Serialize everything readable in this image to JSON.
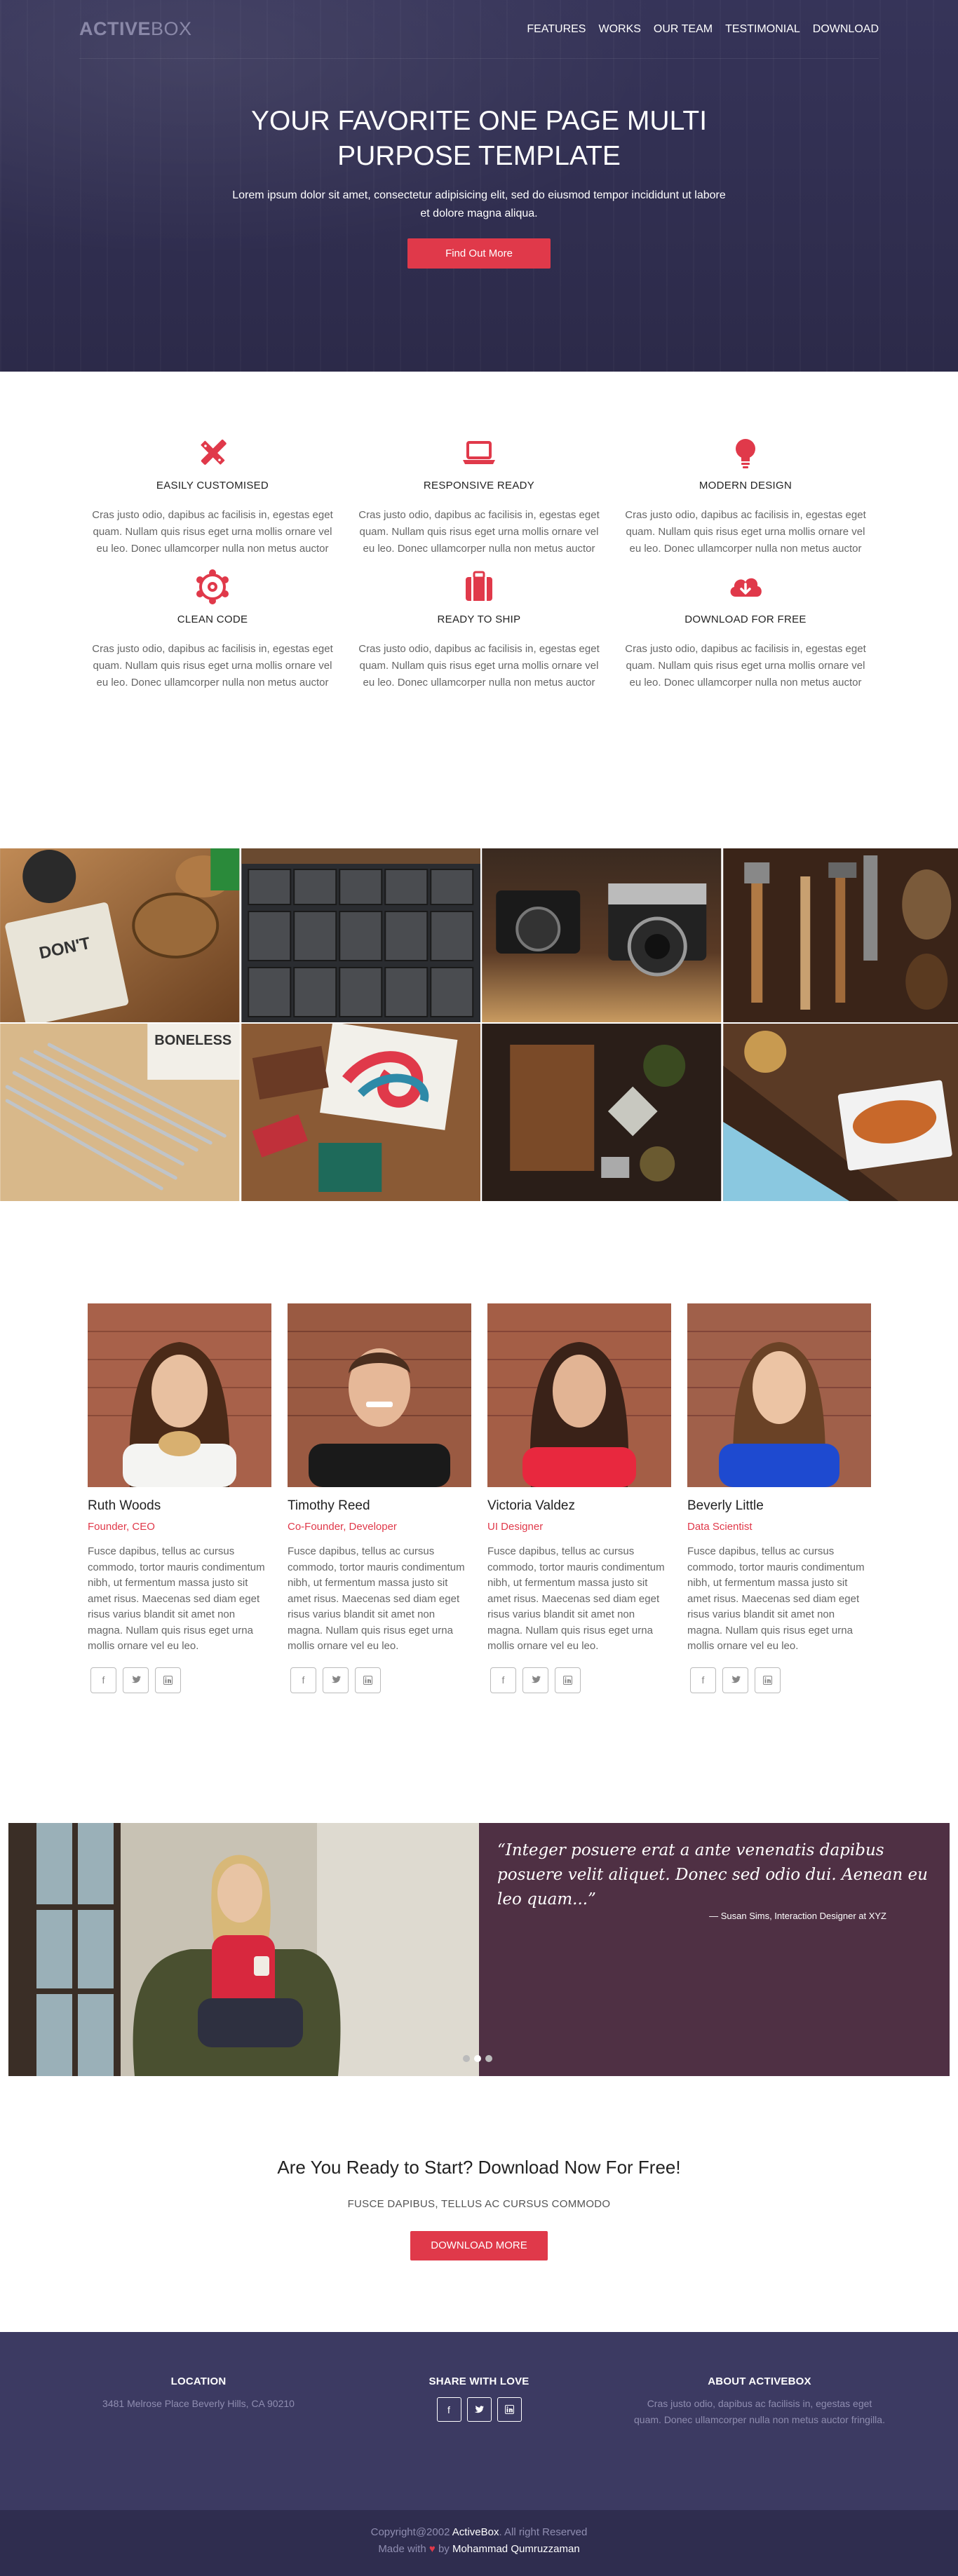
{
  "brand": {
    "logo_bold": "ACTIVE",
    "logo_light": "BOX"
  },
  "nav": {
    "items": [
      "FEATURES",
      "WORKS",
      "OUR TEAM",
      "TESTIMONIAL",
      "DOWNLOAD"
    ]
  },
  "hero": {
    "title": "YOUR FAVORITE ONE PAGE MULTI PURPOSE TEMPLATE",
    "subtitle": "Lorem ipsum dolor sit amet, consectetur adipisicing elit, sed do eiusmod tempor incididunt ut labore et dolore magna aliqua.",
    "button": "Find Out More"
  },
  "features": [
    {
      "title": "EASILY CUSTOMISED",
      "icon": "pencil-ruler-icon",
      "text": "Cras justo odio, dapibus ac facilisis in, egestas eget quam. Nullam quis risus eget urna mollis ornare vel eu leo. Donec ullamcorper nulla non metus auctor"
    },
    {
      "title": "RESPONSIVE READY",
      "icon": "laptop-icon",
      "text": "Cras justo odio, dapibus ac facilisis in, egestas eget quam. Nullam quis risus eget urna mollis ornare vel eu leo. Donec ullamcorper nulla non metus auctor"
    },
    {
      "title": "MODERN DESIGN",
      "icon": "lightbulb-icon",
      "text": "Cras justo odio, dapibus ac facilisis in, egestas eget quam. Nullam quis risus eget urna mollis ornare vel eu leo. Donec ullamcorper nulla non metus auctor"
    },
    {
      "title": "CLEAN CODE",
      "icon": "atom-icon",
      "text": "Cras justo odio, dapibus ac facilisis in, egestas eget quam. Nullam quis risus eget urna mollis ornare vel eu leo. Donec ullamcorper nulla non metus auctor"
    },
    {
      "title": "READY TO SHIP",
      "icon": "suitcase-icon",
      "text": "Cras justo odio, dapibus ac facilisis in, egestas eget quam. Nullam quis risus eget urna mollis ornare vel eu leo. Donec ullamcorper nulla non metus auctor"
    },
    {
      "title": "DOWNLOAD FOR FREE",
      "icon": "cloud-download-icon",
      "text": "Cras justo odio, dapibus ac facilisis in, egestas eget quam. Nullam quis risus eget urna mollis ornare vel eu leo. Donec ullamcorper nulla non metus auctor"
    }
  ],
  "team": [
    {
      "name": "Ruth Woods",
      "role": "Founder, CEO",
      "bio": "Fusce dapibus, tellus ac cursus commodo, tortor mauris condimentum nibh, ut fermentum massa justo sit amet risus. Maecenas sed diam eget risus varius blandit sit amet non magna. Nullam quis risus eget urna mollis ornare vel eu leo."
    },
    {
      "name": "Timothy Reed",
      "role": "Co-Founder, Developer",
      "bio": "Fusce dapibus, tellus ac cursus commodo, tortor mauris condimentum nibh, ut fermentum massa justo sit amet risus. Maecenas sed diam eget risus varius blandit sit amet non magna. Nullam quis risus eget urna mollis ornare vel eu leo."
    },
    {
      "name": "Victoria Valdez",
      "role": "UI Designer",
      "bio": "Fusce dapibus, tellus ac cursus commodo, tortor mauris condimentum nibh, ut fermentum massa justo sit amet risus. Maecenas sed diam eget risus varius blandit sit amet non magna. Nullam quis risus eget urna mollis ornare vel eu leo."
    },
    {
      "name": "Beverly Little",
      "role": "Data Scientist",
      "bio": "Fusce dapibus, tellus ac cursus commodo, tortor mauris condimentum nibh, ut fermentum massa justo sit amet risus. Maecenas sed diam eget risus varius blandit sit amet non magna. Nullam quis risus eget urna mollis ornare vel eu leo."
    }
  ],
  "social_icons": [
    "facebook-icon",
    "twitter-icon",
    "linkedin-icon"
  ],
  "testimonial": {
    "quote": "“Integer posuere erat a ante venenatis dapibus posuere velit aliquet. Donec sed odio dui. Aenean eu leo quam...”",
    "author": "— Susan Sims, Interaction Designer at XYZ"
  },
  "cta": {
    "title": "Are You Ready to Start? Download Now For Free!",
    "subtitle": "FUSCE DAPIBUS, TELLUS AC CURSUS COMMODO",
    "button": "DOWNLOAD MORE"
  },
  "footer": {
    "location_title": "LOCATION",
    "location_text": "3481 Melrose Place Beverly Hills, CA 90210",
    "share_title": "SHARE WITH LOVE",
    "about_title": "ABOUT ACTIVEBOX",
    "about_text": "Cras justo odio, dapibus ac facilisis in, egestas eget quam. Donec ullamcorper nulla non metus auctor fringilla.",
    "copyright_prefix": "Copyright@2002",
    "copyright_brand": "ActiveBox",
    "copyright_suffix": ". All right Reserved",
    "made_with": "Made with",
    "made_by": "by",
    "author": "Mohammad Qumruzzaman"
  },
  "colors": {
    "accent": "#e0394a",
    "hero_bg": "#2f2d4d",
    "footer_bg": "#3c3a62",
    "testimonial_bg": "#4f3044"
  }
}
